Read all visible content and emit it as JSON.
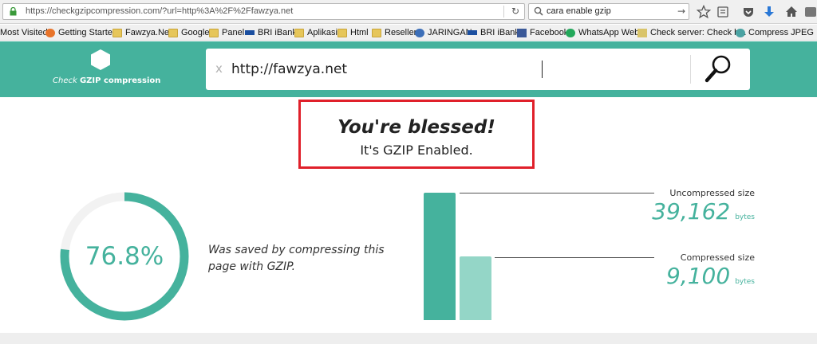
{
  "browser": {
    "url": "https://checkgzipcompression.com/?url=http%3A%2F%2Ffawzya.net",
    "search_query": "cara enable gzip",
    "bookmarks": [
      {
        "label": "Most Visited",
        "icon": "gear-icon"
      },
      {
        "label": "Getting Started",
        "icon": "firefox-icon"
      },
      {
        "label": "Fawzya.Net",
        "icon": "folder-icon"
      },
      {
        "label": "Google",
        "icon": "folder-icon"
      },
      {
        "label": "Panel",
        "icon": "folder-icon"
      },
      {
        "label": "BRI iBank",
        "icon": "bri-icon"
      },
      {
        "label": "Aplikasi",
        "icon": "folder-icon"
      },
      {
        "label": "Html",
        "icon": "folder-icon"
      },
      {
        "label": "Reseller",
        "icon": "folder-icon"
      },
      {
        "label": "JARINGAN",
        "icon": "globe-icon"
      },
      {
        "label": "BRI iBank",
        "icon": "bri-icon"
      },
      {
        "label": "Facebook",
        "icon": "facebook-icon"
      },
      {
        "label": "WhatsApp Web",
        "icon": "whatsapp-icon"
      },
      {
        "label": "Check server: Check h...",
        "icon": "server-icon"
      },
      {
        "label": "Compress JPEG Imag",
        "icon": "compress-icon"
      }
    ]
  },
  "site": {
    "logo_prefix": "Check",
    "logo_bold": "GZIP compression",
    "input_value": "http://fawzya.net",
    "clear_symbol": "x"
  },
  "result": {
    "title": "You're blessed!",
    "subtitle": "It's GZIP Enabled."
  },
  "stats": {
    "percent": "76.8%",
    "percent_value": 76.8,
    "saved_text": "Was saved by compressing this page with GZIP.",
    "uncompressed_label": "Uncompressed size",
    "uncompressed_value": "39,162",
    "compressed_label": "Compressed size",
    "compressed_value": "9,100",
    "unit": "bytes"
  },
  "colors": {
    "brand": "#45b29d",
    "brand_light": "#94d6c7",
    "highlight_border": "#e0202a"
  }
}
